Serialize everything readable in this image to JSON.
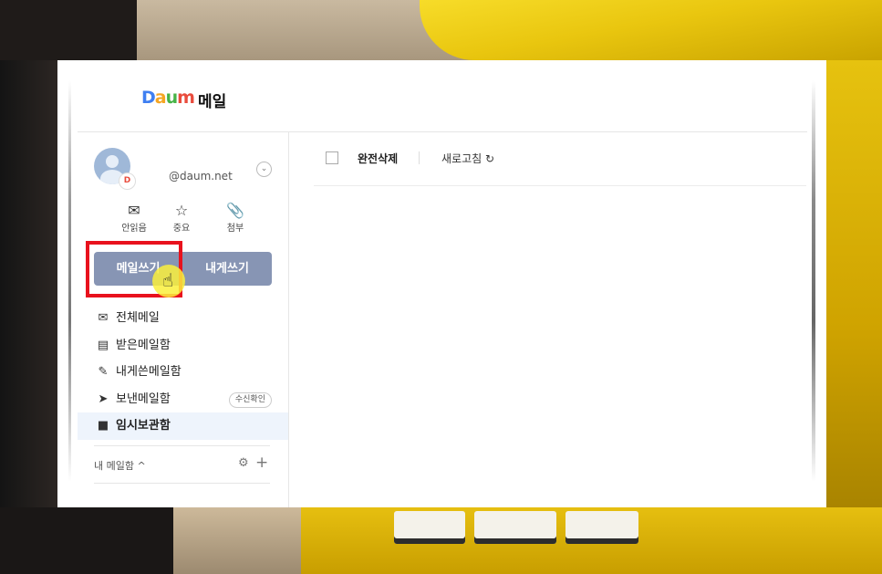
{
  "header": {
    "logo_letters": [
      "D",
      "a",
      "u",
      "m"
    ],
    "title": "메일"
  },
  "account": {
    "email": "@daum.net",
    "badge": "D",
    "toggle_icon": "chevron-down-icon"
  },
  "quick_filters": [
    {
      "icon": "envelope-icon",
      "label": "안읽음"
    },
    {
      "icon": "star-icon",
      "label": "중요"
    },
    {
      "icon": "paperclip-icon",
      "label": "첨부"
    }
  ],
  "compose": {
    "write_label": "메일쓰기",
    "self_label": "내게쓰기"
  },
  "folders": [
    {
      "icon": "mail-icon",
      "label": "전체메일",
      "active": false
    },
    {
      "icon": "inbox-icon",
      "label": "받은메일함",
      "active": false
    },
    {
      "icon": "edit-icon",
      "label": "내게쓴메일함",
      "active": false
    },
    {
      "icon": "send-icon",
      "label": "보낸메일함",
      "active": false,
      "chip": "수신확인"
    },
    {
      "icon": "folder-icon",
      "label": "임시보관함",
      "active": true
    }
  ],
  "my_mailbox": {
    "label": "내 메일함 ^"
  },
  "toolbar": {
    "delete_label": "완전삭제",
    "refresh_label": "새로고침 ↻"
  },
  "colors": {
    "compose_button": "#8795b4",
    "highlight": "#e8121d",
    "active_folder_bg": "#eef4fc"
  }
}
